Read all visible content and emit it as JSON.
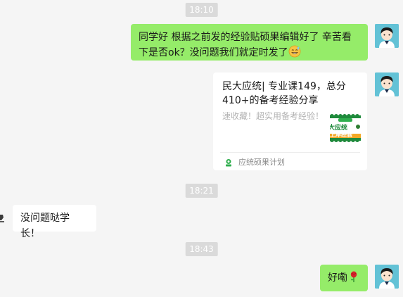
{
  "messages": {
    "ts1": "18:10",
    "msg1": "同学好 根据之前发的经验贴硕果编辑好了 辛苦看下是否ok？没问题我们就定时发了",
    "card": {
      "title": "民大应统| 专业课149，总分410+的备考经验分享",
      "desc": "速收藏！超实用备考经验！",
      "thumb_line1": "大应统",
      "thumb_line2": "上岸经验",
      "source": "应统硕果计划"
    },
    "ts2": "18:21",
    "msg2": "没问题哒学长！",
    "ts3": "18:43",
    "msg3": "好嘞"
  },
  "colors": {
    "sent_bubble": "#95ec69",
    "received_bubble": "#ffffff",
    "background": "#f5f5f5",
    "timestamp_bg": "#dadada"
  },
  "icons": [
    "avatar",
    "grinning-sweat-emoji",
    "rose-emoji",
    "mini-program-icon"
  ]
}
